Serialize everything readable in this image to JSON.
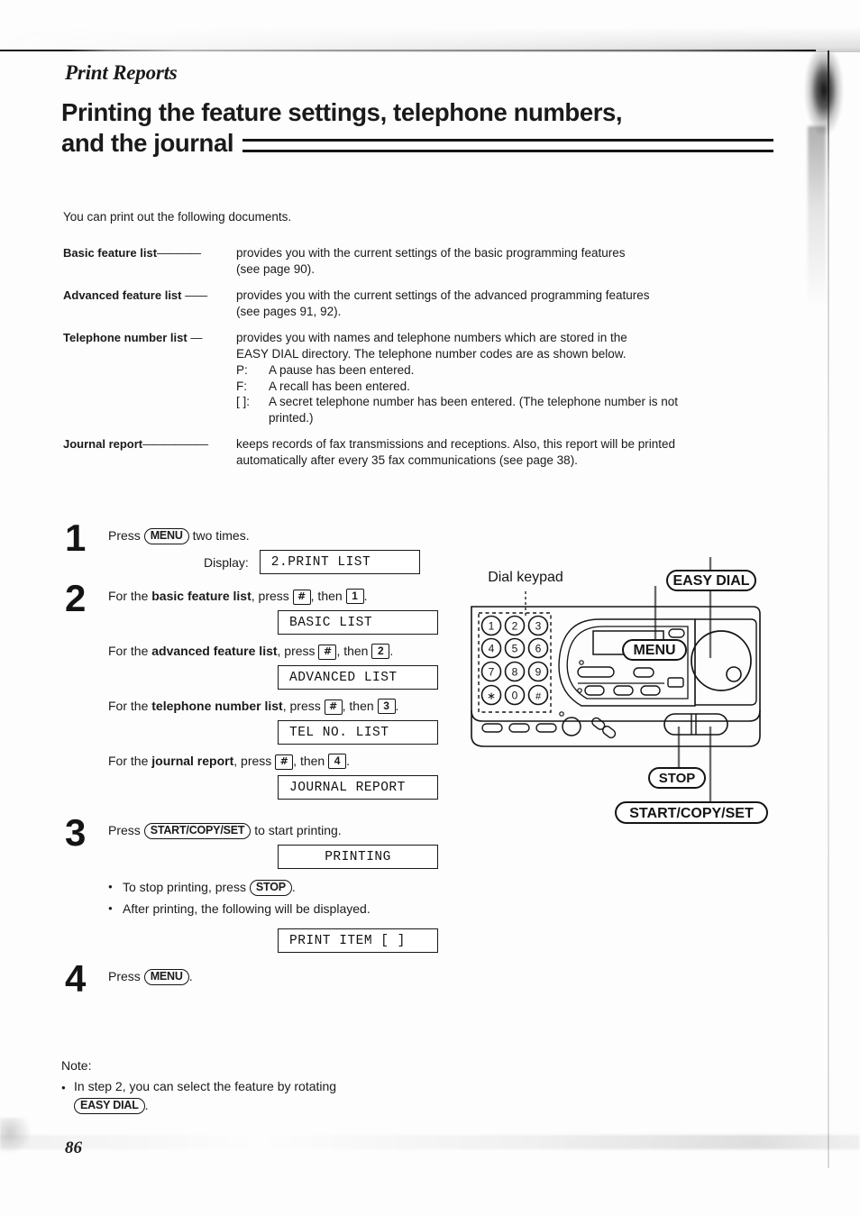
{
  "page": {
    "running_head": "Print Reports",
    "title_line1": "Printing the feature settings, telephone numbers,",
    "title_line2": "and the journal",
    "page_number": "86",
    "intro": "You can print out the following documents."
  },
  "definitions": [
    {
      "term": "Basic feature list",
      "dashes": "————",
      "lines": [
        "provides you with the current settings of the basic programming features",
        "(see page 90)."
      ]
    },
    {
      "term": "Advanced feature list",
      "dashes": "——",
      "lines": [
        "provides you with the current settings of the advanced programming features",
        "(see pages 91, 92)."
      ]
    },
    {
      "term": "Telephone number list",
      "dashes": "—",
      "lines": [
        "provides you with names and telephone numbers which are stored in the",
        "EASY DIAL directory. The telephone number codes are as shown below."
      ],
      "codes": [
        {
          "key": "P:",
          "text": "A pause has been entered."
        },
        {
          "key": "F:",
          "text": "A recall has been entered."
        },
        {
          "key": "[  ]:",
          "text": "A secret telephone number has been entered. (The telephone number is not"
        }
      ],
      "codes_continuation": "printed.)"
    },
    {
      "term": "Journal report",
      "dashes": "——————",
      "lines": [
        "keeps records of fax transmissions and receptions. Also, this report will be printed",
        "automatically after every 35 fax communications (see page 38)."
      ]
    }
  ],
  "steps": {
    "step1": {
      "number": "1",
      "text_before": "Press",
      "key": "MENU",
      "text_after": "two times.",
      "display_label": "Display:",
      "display_value": "2.PRINT LIST"
    },
    "step2": {
      "number": "2",
      "options": [
        {
          "prefix": "For the",
          "bold": "basic feature list",
          "middle": ", press",
          "key1": "#",
          "middle2": ", then",
          "key2": "1",
          "suffix": ".",
          "display_value": "BASIC LIST"
        },
        {
          "prefix": "For the",
          "bold": "advanced feature list",
          "middle": ", press",
          "key1": "#",
          "middle2": ", then",
          "key2": "2",
          "suffix": ".",
          "display_value": "ADVANCED LIST"
        },
        {
          "prefix": "For the",
          "bold": "telephone number list",
          "middle": ", press",
          "key1": "#",
          "middle2": ", then",
          "key2": "3",
          "suffix": ".",
          "display_value": "TEL NO. LIST"
        },
        {
          "prefix": "For the",
          "bold": "journal report",
          "middle": ", press",
          "key1": "#",
          "middle2": ", then",
          "key2": "4",
          "suffix": ".",
          "display_value": "JOURNAL REPORT"
        }
      ]
    },
    "step3": {
      "number": "3",
      "text_before": "Press",
      "key": "START/COPY/SET",
      "text_after": "to start printing.",
      "display_value": "PRINTING",
      "bullet1_before": "To stop printing, press",
      "bullet1_key": "STOP",
      "bullet1_after": ".",
      "bullet2": "After printing, the following will be displayed.",
      "display_value2": "PRINT ITEM [ ]"
    },
    "step4": {
      "number": "4",
      "text_before": "Press",
      "key": "MENU",
      "text_after": "."
    }
  },
  "note": {
    "title": "Note:",
    "line1_before": "In step 2, you can select the feature by rotating",
    "key": "EASY DIAL",
    "line1_after": "."
  },
  "figure": {
    "caption_keypad": "Dial keypad",
    "callout_menu": "MENU",
    "callout_easy_dial": "EASY DIAL",
    "callout_stop": "STOP",
    "callout_start": "START/COPY/SET",
    "keypad_keys": [
      "1",
      "2",
      "3",
      "4",
      "5",
      "6",
      "7",
      "8",
      "9",
      "∗",
      "0",
      "#"
    ]
  }
}
